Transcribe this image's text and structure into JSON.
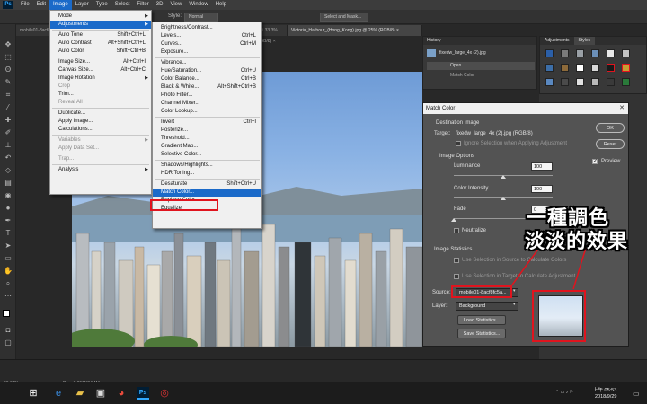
{
  "menubar": {
    "logo": "Ps",
    "items": [
      "File",
      "Edit",
      "Image",
      "Layer",
      "Type",
      "Select",
      "Filter",
      "3D",
      "View",
      "Window",
      "Help"
    ],
    "active_index": 2
  },
  "optbar": {
    "style_label": "Style:",
    "style_value": "Normal",
    "select_mask": "Select and Mask..."
  },
  "tabs": [
    {
      "label": "mobile01-8acf8f...",
      "active": false
    },
    {
      "label": "...@ 33.3% (RGB/8) ×",
      "active": false
    },
    {
      "label": "Victoria_Harbour_(Hong_Kong).jpg @ 25% (RGB/8) ×",
      "active": true
    }
  ],
  "image_menu": {
    "items": [
      {
        "label": "Mode",
        "sc": "",
        "arrow": true,
        "disabled": false,
        "hl": false
      },
      {
        "label": "Adjustments",
        "sc": "",
        "arrow": true,
        "disabled": false,
        "hl": true
      },
      {
        "sep": true
      },
      {
        "label": "Auto Tone",
        "sc": "Shift+Ctrl+L",
        "arrow": false,
        "disabled": false,
        "hl": false
      },
      {
        "label": "Auto Contrast",
        "sc": "Alt+Shift+Ctrl+L",
        "arrow": false,
        "disabled": false,
        "hl": false
      },
      {
        "label": "Auto Color",
        "sc": "Shift+Ctrl+B",
        "arrow": false,
        "disabled": false,
        "hl": false
      },
      {
        "sep": true
      },
      {
        "label": "Image Size...",
        "sc": "Alt+Ctrl+I",
        "arrow": false,
        "disabled": false,
        "hl": false
      },
      {
        "label": "Canvas Size...",
        "sc": "Alt+Ctrl+C",
        "arrow": false,
        "disabled": false,
        "hl": false
      },
      {
        "label": "Image Rotation",
        "sc": "",
        "arrow": true,
        "disabled": false,
        "hl": false
      },
      {
        "label": "Crop",
        "sc": "",
        "arrow": false,
        "disabled": true,
        "hl": false
      },
      {
        "label": "Trim...",
        "sc": "",
        "arrow": false,
        "disabled": false,
        "hl": false
      },
      {
        "label": "Reveal All",
        "sc": "",
        "arrow": false,
        "disabled": true,
        "hl": false
      },
      {
        "sep": true
      },
      {
        "label": "Duplicate...",
        "sc": "",
        "arrow": false,
        "disabled": false,
        "hl": false
      },
      {
        "label": "Apply Image...",
        "sc": "",
        "arrow": false,
        "disabled": false,
        "hl": false
      },
      {
        "label": "Calculations...",
        "sc": "",
        "arrow": false,
        "disabled": false,
        "hl": false
      },
      {
        "sep": true
      },
      {
        "label": "Variables",
        "sc": "",
        "arrow": true,
        "disabled": true,
        "hl": false
      },
      {
        "label": "Apply Data Set...",
        "sc": "",
        "arrow": false,
        "disabled": true,
        "hl": false
      },
      {
        "sep": true
      },
      {
        "label": "Trap...",
        "sc": "",
        "arrow": false,
        "disabled": true,
        "hl": false
      },
      {
        "sep": true
      },
      {
        "label": "Analysis",
        "sc": "",
        "arrow": true,
        "disabled": false,
        "hl": false
      }
    ]
  },
  "adjust_menu": {
    "items": [
      {
        "label": "Brightness/Contrast...",
        "sc": "",
        "hl": false
      },
      {
        "label": "Levels...",
        "sc": "Ctrl+L",
        "hl": false
      },
      {
        "label": "Curves...",
        "sc": "Ctrl+M",
        "hl": false
      },
      {
        "label": "Exposure...",
        "sc": "",
        "hl": false
      },
      {
        "sep": true
      },
      {
        "label": "Vibrance...",
        "sc": "",
        "hl": false
      },
      {
        "label": "Hue/Saturation...",
        "sc": "Ctrl+U",
        "hl": false
      },
      {
        "label": "Color Balance...",
        "sc": "Ctrl+B",
        "hl": false
      },
      {
        "label": "Black & White...",
        "sc": "Alt+Shift+Ctrl+B",
        "hl": false
      },
      {
        "label": "Photo Filter...",
        "sc": "",
        "hl": false
      },
      {
        "label": "Channel Mixer...",
        "sc": "",
        "hl": false
      },
      {
        "label": "Color Lookup...",
        "sc": "",
        "hl": false
      },
      {
        "sep": true
      },
      {
        "label": "Invert",
        "sc": "Ctrl+I",
        "hl": false
      },
      {
        "label": "Posterize...",
        "sc": "",
        "hl": false
      },
      {
        "label": "Threshold...",
        "sc": "",
        "hl": false
      },
      {
        "label": "Gradient Map...",
        "sc": "",
        "hl": false
      },
      {
        "label": "Selective Color...",
        "sc": "",
        "hl": false
      },
      {
        "sep": true
      },
      {
        "label": "Shadows/Highlights...",
        "sc": "",
        "hl": false
      },
      {
        "label": "HDR Toning...",
        "sc": "",
        "hl": false
      },
      {
        "sep": true
      },
      {
        "label": "Desaturate",
        "sc": "Shift+Ctrl+U",
        "hl": false
      },
      {
        "label": "Match Color...",
        "sc": "",
        "hl": true
      },
      {
        "label": "Replace Color...",
        "sc": "",
        "hl": false
      },
      {
        "label": "Equalize",
        "sc": "",
        "hl": false
      }
    ]
  },
  "history": {
    "title": "History",
    "doc": "fixedw_large_4x (2).jpg",
    "items": [
      "Open",
      "Match Color"
    ]
  },
  "adj_panel": {
    "tab1": "Adjustments",
    "tab2": "Styles"
  },
  "dialog": {
    "title": "Match Color",
    "destination_heading": "Destination Image",
    "target_label": "Target:",
    "target_value": "fixedw_large_4x (2).jpg (RGB/8)",
    "ignore_selection": "Ignore Selection when Applying Adjustment",
    "image_options_heading": "Image Options",
    "luminance_label": "Luminance",
    "luminance_value": "100",
    "luminance_fraction": 0.5,
    "color_intensity_label": "Color Intensity",
    "color_intensity_value": "100",
    "color_intensity_fraction": 0.5,
    "fade_label": "Fade",
    "fade_value": "0",
    "fade_fraction": 0.0,
    "neutralize_label": "Neutralize",
    "image_stats_heading": "Image Statistics",
    "use_sel_source": "Use Selection in Source to Calculate Colors",
    "use_sel_target": "Use Selection in Target to Calculate Adjustment",
    "source_label": "Source:",
    "source_value": "mobile01-8acf8fc5a...",
    "layer_label": "Layer:",
    "layer_value": "Background",
    "load_stats": "Load Statistics...",
    "save_stats": "Save Statistics...",
    "ok": "OK",
    "reset": "Reset",
    "preview_label": "Preview",
    "preview_checked": true
  },
  "annotation": {
    "line1": "一種調色",
    "line2": "淡淡的效果",
    "color": "#e0141e"
  },
  "status": {
    "zoom": "66.67%",
    "doc": "Doc: 3.21M/7.54M"
  },
  "taskbar": {
    "time": "上午 05:53",
    "date": "2018/9/29"
  },
  "colors": {
    "accent": "#1b6ac9",
    "highlight_red": "#e0141e"
  }
}
